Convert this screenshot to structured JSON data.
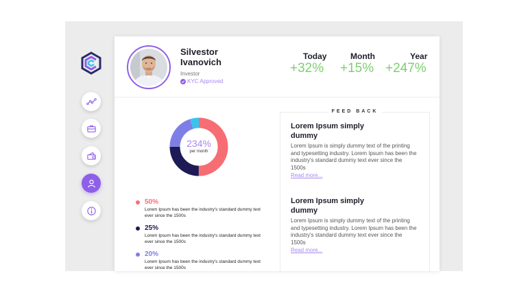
{
  "profile": {
    "name": "Silvestor Ivanovich",
    "role": "Investor",
    "kyc_status": "KYC Approved"
  },
  "stats": [
    {
      "label": "Today",
      "value": "+32%"
    },
    {
      "label": "Month",
      "value": "+15%"
    },
    {
      "label": "Year",
      "value": "+247%"
    }
  ],
  "sidebar": {
    "logo": "c-logo-icon",
    "items": [
      {
        "icon": "line-chart-icon",
        "active": false
      },
      {
        "icon": "briefcase-icon",
        "active": false
      },
      {
        "icon": "wallet-icon",
        "active": false
      },
      {
        "icon": "user-icon",
        "active": true
      },
      {
        "icon": "info-icon",
        "active": false
      }
    ]
  },
  "donut": {
    "value": "234%",
    "caption": "per month",
    "segments": [
      {
        "color": "#f76d74",
        "fraction": 0.5
      },
      {
        "color": "#1d1a55",
        "fraction": 0.25
      },
      {
        "color": "#7e7fe6",
        "fraction": 0.2
      },
      {
        "color": "#37c5ef",
        "fraction": 0.05
      }
    ]
  },
  "legend": [
    {
      "percent": "50%",
      "color": "#f76d74",
      "text": "Lorem Ipsum has been the industry's standard dummy text ever since the 1500s"
    },
    {
      "percent": "25%",
      "color": "#1d1a55",
      "text": "Lorem Ipsum has been the industry's standard dummy text ever since the 1500s"
    },
    {
      "percent": "20%",
      "color": "#7e7fe6",
      "text": "Lorem Ipsum has been the industry's standard dummy text ever since the 1500s"
    }
  ],
  "feedback": {
    "title": "FEED BACK",
    "items": [
      {
        "heading": "Lorem Ipsum simply dummy",
        "body": "Lorem Ipsum is simply dummy text of the printing and typesetting industry. Lorem Ipsum has been the industry's standard dummy text ever since the 1500s",
        "link": "Read more..."
      },
      {
        "heading": "Lorem Ipsum simply dummy",
        "body": "Lorem Ipsum is simply dummy text of the printing and typesetting industry. Lorem Ipsum has been the industry's standard dummy text ever since the 1500s",
        "link": "Read more..."
      }
    ]
  },
  "colors": {
    "accent": "#8e5fe8",
    "positive": "#7ccf6e"
  }
}
